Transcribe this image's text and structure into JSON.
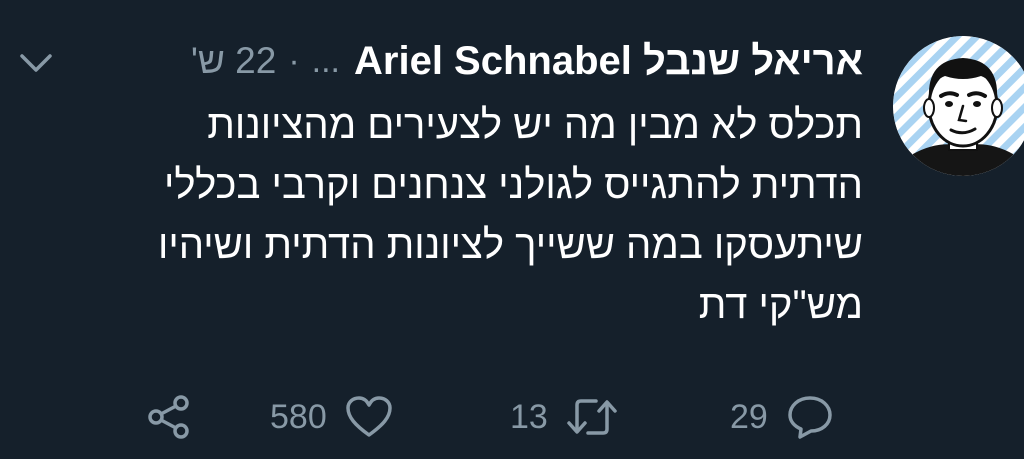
{
  "tweet": {
    "author": {
      "display_name": "אריאל שנבל Ariel Schnabel",
      "handle": "...",
      "avatar": "cartoon-man-avatar-icon"
    },
    "separator": "·",
    "timestamp": "22 ש'",
    "text_lines": [
      "תכלס לא מבין מה יש לצעירים מהציונות",
      "הדתית להתגייס לגולני צנחנים וקרבי בכללי",
      "שיתעסקו במה ששייך לציונות הדתית ושיהיו",
      "מש\"קי דת"
    ],
    "actions": {
      "share_icon": "share-icon",
      "likes": "580",
      "like_icon": "heart-icon",
      "retweets": "13",
      "retweet_icon": "retweet-icon",
      "replies": "29",
      "reply_icon": "reply-icon"
    },
    "menu_icon": "chevron-down-icon"
  },
  "colors": {
    "background": "#15202b",
    "text_primary": "#ffffff",
    "text_secondary": "#8899a6"
  }
}
